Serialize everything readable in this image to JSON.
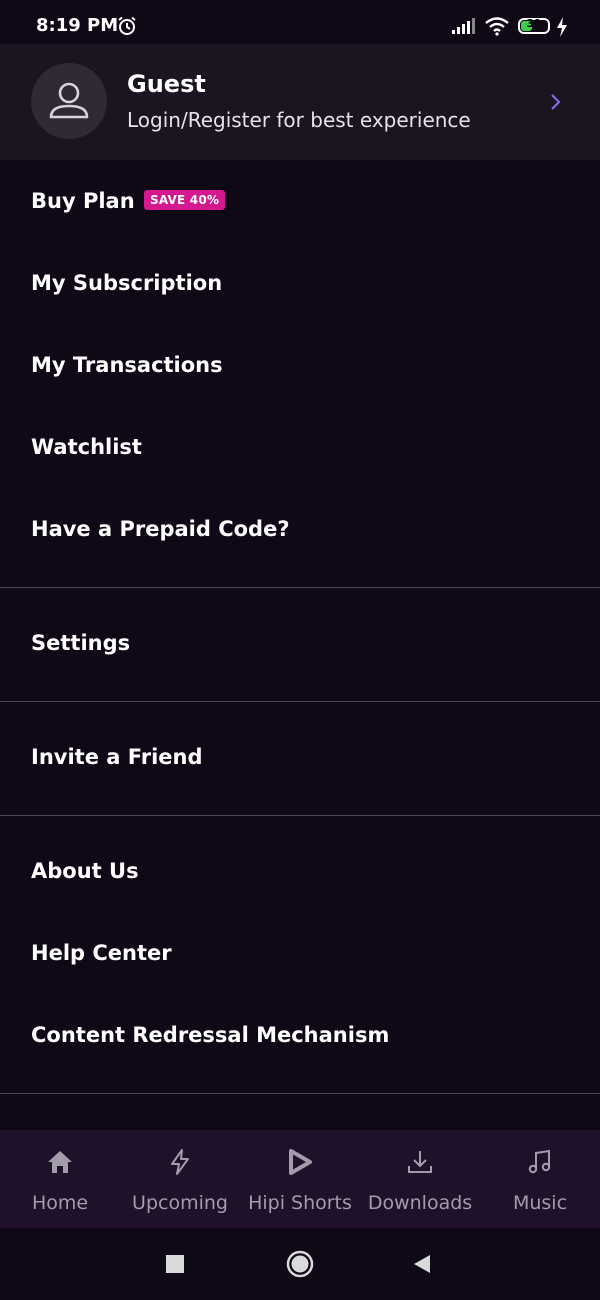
{
  "status_bar": {
    "time": "8:19 PM",
    "battery": "31",
    "icons": [
      "alarm-icon",
      "signal-icon",
      "wifi-icon",
      "battery-icon",
      "charging-icon"
    ]
  },
  "profile": {
    "name": "Guest",
    "subtitle": "Login/Register for best experience",
    "avatar_icon": "user-icon",
    "chevron_icon": "chevron-right-icon"
  },
  "menu": {
    "buy_plan": "Buy Plan",
    "save_badge": "SAVE 40%",
    "my_subscription": "My Subscription",
    "my_transactions": "My Transactions",
    "watchlist": "Watchlist",
    "prepaid_code": "Have a Prepaid Code?",
    "settings": "Settings",
    "invite_friend": "Invite a Friend",
    "about_us": "About Us",
    "help_center": "Help Center",
    "content_redressal": "Content Redressal Mechanism"
  },
  "bottom_nav": {
    "items": [
      {
        "label": "Home",
        "icon": "home-icon"
      },
      {
        "label": "Upcoming",
        "icon": "lightning-icon"
      },
      {
        "label": "Hipi Shorts",
        "icon": "hipi-icon"
      },
      {
        "label": "Downloads",
        "icon": "download-icon"
      },
      {
        "label": "Music",
        "icon": "music-note-icon"
      }
    ]
  },
  "colors": {
    "background": "#0f0817",
    "header": "#1b1521",
    "badge": "#d4198f",
    "bottom_nav": "#1e1129",
    "accent": "#8b6cf0"
  }
}
